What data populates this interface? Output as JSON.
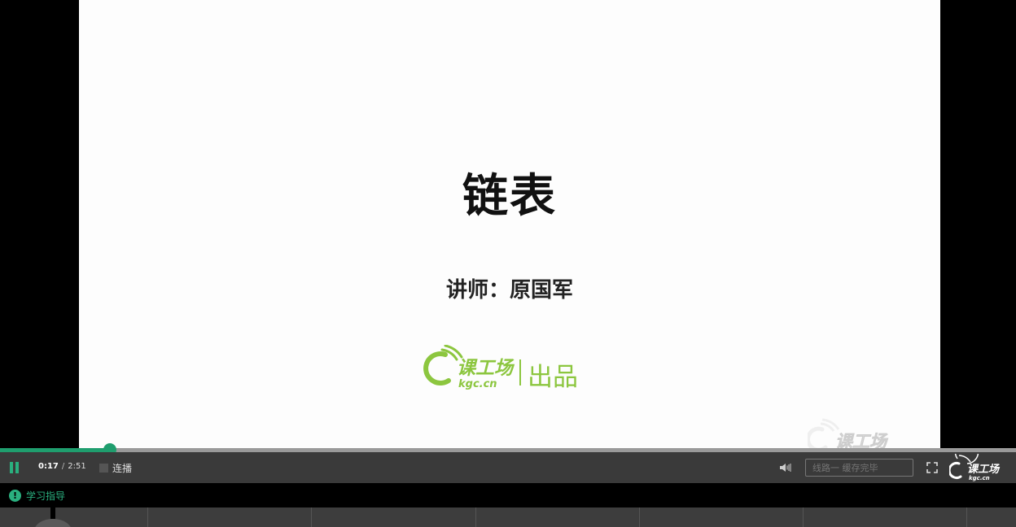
{
  "slide": {
    "title": "链表",
    "lecturer": "讲师：原国军",
    "brand_name": "课工场",
    "brand_domain": "kgc.cn",
    "brand_suffix": "出品"
  },
  "watermark": {
    "text": "课工场"
  },
  "player": {
    "progress_fraction": 0.108,
    "current_time": "0:17",
    "separator": "/",
    "duration": "2:51",
    "autoplay_label": "连播",
    "autoplay_checked": false,
    "line_select_value": "线路一 缓存完毕",
    "corner_logo_name": "课工场",
    "corner_logo_domain": "kgc.cn"
  },
  "guide": {
    "label": "学习指导"
  },
  "colors": {
    "accent": "#1f9e6e",
    "brand_green": "#8cc63f",
    "slide_bg": "#fdfdfd",
    "control_bar": "#3a3a3a"
  },
  "icons": [
    "pause-icon",
    "volume-icon",
    "fullscreen-icon",
    "info-icon",
    "kgc-logo-icon"
  ]
}
